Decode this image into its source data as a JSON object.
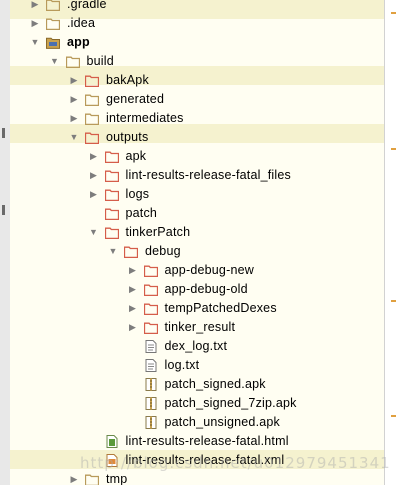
{
  "tree": {
    "rows": [
      {
        "label": ".gradle",
        "depth": 0,
        "arrow": "collapsed",
        "icon": "folder-icon",
        "bold": false
      },
      {
        "label": ".idea",
        "depth": 0,
        "arrow": "collapsed",
        "icon": "folder-icon",
        "bold": false
      },
      {
        "label": "app",
        "depth": 0,
        "arrow": "expanded",
        "icon": "module-folder-icon",
        "bold": true
      },
      {
        "label": "build",
        "depth": 1,
        "arrow": "expanded",
        "icon": "folder-icon",
        "bold": false
      },
      {
        "label": "bakApk",
        "depth": 2,
        "arrow": "collapsed",
        "icon": "excluded-folder-icon",
        "bold": false
      },
      {
        "label": "generated",
        "depth": 2,
        "arrow": "collapsed",
        "icon": "folder-icon",
        "bold": false
      },
      {
        "label": "intermediates",
        "depth": 2,
        "arrow": "collapsed",
        "icon": "folder-icon",
        "bold": false
      },
      {
        "label": "outputs",
        "depth": 2,
        "arrow": "expanded",
        "icon": "excluded-folder-icon",
        "bold": false
      },
      {
        "label": "apk",
        "depth": 3,
        "arrow": "collapsed",
        "icon": "excluded-folder-icon",
        "bold": false
      },
      {
        "label": "lint-results-release-fatal_files",
        "depth": 3,
        "arrow": "collapsed",
        "icon": "excluded-folder-icon",
        "bold": false
      },
      {
        "label": "logs",
        "depth": 3,
        "arrow": "collapsed",
        "icon": "excluded-folder-icon",
        "bold": false
      },
      {
        "label": "patch",
        "depth": 3,
        "arrow": "none",
        "icon": "excluded-folder-icon",
        "bold": false
      },
      {
        "label": "tinkerPatch",
        "depth": 3,
        "arrow": "expanded",
        "icon": "excluded-folder-icon",
        "bold": false
      },
      {
        "label": "debug",
        "depth": 4,
        "arrow": "expanded",
        "icon": "excluded-folder-icon",
        "bold": false
      },
      {
        "label": "app-debug-new",
        "depth": 5,
        "arrow": "collapsed",
        "icon": "excluded-folder-icon",
        "bold": false
      },
      {
        "label": "app-debug-old",
        "depth": 5,
        "arrow": "collapsed",
        "icon": "excluded-folder-icon",
        "bold": false
      },
      {
        "label": "tempPatchedDexes",
        "depth": 5,
        "arrow": "collapsed",
        "icon": "excluded-folder-icon",
        "bold": false
      },
      {
        "label": "tinker_result",
        "depth": 5,
        "arrow": "collapsed",
        "icon": "excluded-folder-icon",
        "bold": false
      },
      {
        "label": "dex_log.txt",
        "depth": 5,
        "arrow": "none",
        "icon": "text-file-icon",
        "bold": false
      },
      {
        "label": "log.txt",
        "depth": 5,
        "arrow": "none",
        "icon": "text-file-icon",
        "bold": false
      },
      {
        "label": "patch_signed.apk",
        "depth": 5,
        "arrow": "none",
        "icon": "archive-file-icon",
        "bold": false
      },
      {
        "label": "patch_signed_7zip.apk",
        "depth": 5,
        "arrow": "none",
        "icon": "archive-file-icon",
        "bold": false
      },
      {
        "label": "patch_unsigned.apk",
        "depth": 5,
        "arrow": "none",
        "icon": "archive-file-icon",
        "bold": false
      },
      {
        "label": "lint-results-release-fatal.html",
        "depth": 3,
        "arrow": "none",
        "icon": "html-file-icon",
        "bold": false
      },
      {
        "label": "lint-results-release-fatal.xml",
        "depth": 3,
        "arrow": "none",
        "icon": "xml-file-icon",
        "bold": false
      },
      {
        "label": "tmp",
        "depth": 2,
        "arrow": "collapsed",
        "icon": "folder-icon",
        "bold": false
      }
    ]
  },
  "watermark": "http://blog.csdn.net/u012979451341",
  "colors": {
    "panel_background": "#fffef2",
    "highlight_band": "#f5f2cf",
    "excluded_folder": "#d55d4a",
    "plain_folder": "#b89a5a",
    "module_folder": "#c9a24e"
  }
}
